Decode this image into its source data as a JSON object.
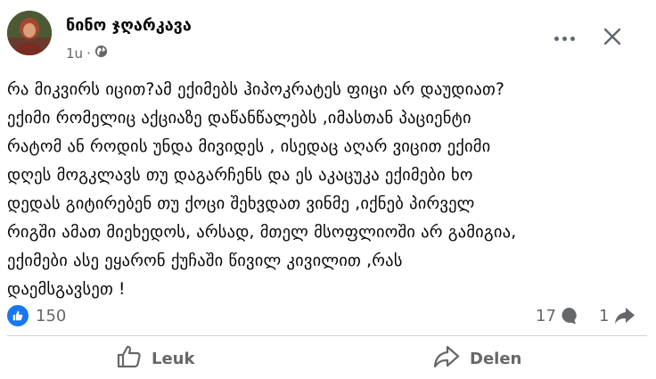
{
  "post": {
    "author": "ნინო ჯღარკავა",
    "time": "1u",
    "meta_separator": "·",
    "text": "რა მიკვირს იცით?ამ ექიმებს ჰიპოკრატეს ფიცი არ დაუდიათ?\nექიმი რომელიც აქციაზე დაწანწალებს ,იმასთან პაციენტი\nრატომ ან როდის უნდა მივიდეს , ისედაც აღარ ვიცით ექიმი\nდღეს მოგკლავს თუ დაგარჩენს და ეს აკაცუკა ექიმები ხო\nდედას გიტირებენ თუ ქოცი შეხვდათ ვინმე ,იქნებ პირველ\nრიგში ამათ მიეხედოს, არსად, მთელ მსოფლიოში არ გამიგია,\nექიმები ასე ეყარონ ქუჩაში წივილ კივილით ,რას\nდაემსგავსეთ !"
  },
  "stats": {
    "likes": "150",
    "comments": "17",
    "shares": "1"
  },
  "actions": {
    "like_label": "Leuk",
    "share_label": "Delen"
  },
  "icons": {
    "privacy": "globe-icon",
    "more": "more-dots-icon",
    "close": "close-icon",
    "like_reaction": "thumbs-up-icon",
    "comment": "comment-bubble-icon",
    "share": "share-arrow-icon"
  },
  "colors": {
    "like_blue": "#1877f2",
    "secondary_text": "#65676b"
  }
}
